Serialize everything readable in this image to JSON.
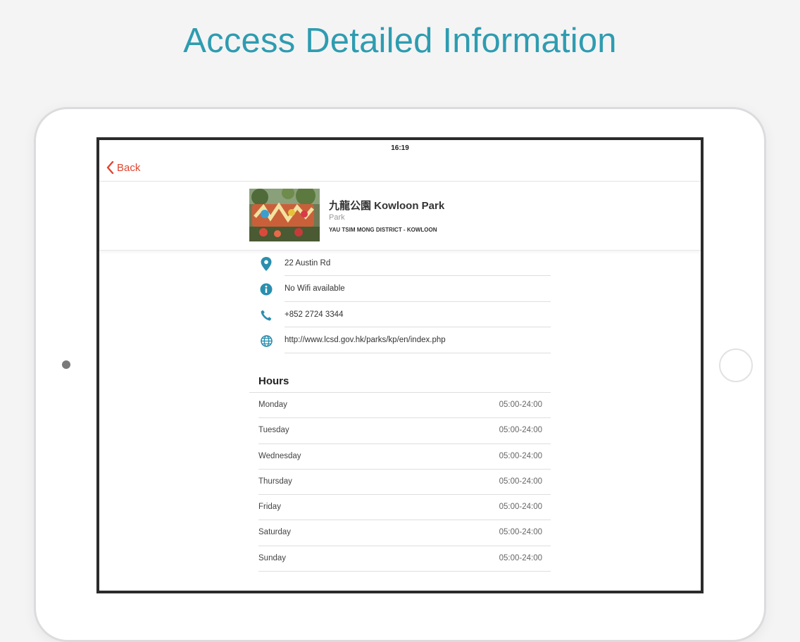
{
  "headline": "Access Detailed Information",
  "status_bar": {
    "time": "16:19"
  },
  "nav": {
    "back_label": "Back"
  },
  "place": {
    "title": "九龍公園 Kowloon Park",
    "type": "Park",
    "district": "YAU TSIM MONG DISTRICT - KOWLOON"
  },
  "info": [
    {
      "icon": "location-pin-icon",
      "text": "22 Austin Rd"
    },
    {
      "icon": "info-icon",
      "text": "No Wifi available"
    },
    {
      "icon": "phone-icon",
      "text": "+852 2724 3344"
    },
    {
      "icon": "globe-icon",
      "text": "http://www.lcsd.gov.hk/parks/kp/en/index.php"
    }
  ],
  "hours": {
    "title": "Hours",
    "rows": [
      {
        "day": "Monday",
        "time": "05:00-24:00"
      },
      {
        "day": "Tuesday",
        "time": "05:00-24:00"
      },
      {
        "day": "Wednesday",
        "time": "05:00-24:00"
      },
      {
        "day": "Thursday",
        "time": "05:00-24:00"
      },
      {
        "day": "Friday",
        "time": "05:00-24:00"
      },
      {
        "day": "Saturday",
        "time": "05:00-24:00"
      },
      {
        "day": "Sunday",
        "time": "05:00-24:00"
      }
    ]
  },
  "colors": {
    "accent": "#2e9cb0",
    "back": "#e0452f",
    "icon": "#2a8fae"
  }
}
